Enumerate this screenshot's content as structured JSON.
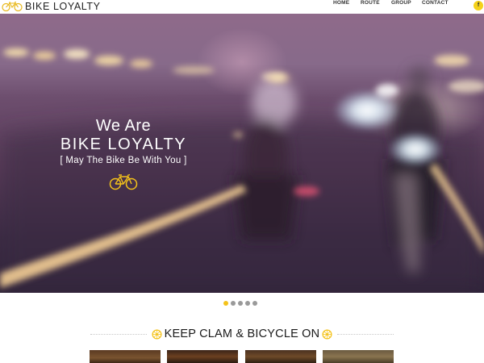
{
  "header": {
    "logo_text": "BIKE  LOYALTY",
    "nav": {
      "home": "HOME",
      "route": "ROUTE",
      "group": "GROUP",
      "contact": "CONTACT"
    },
    "facebook_letter": "f"
  },
  "hero": {
    "line1": "We Are",
    "line2": "BIKE  LOYALTY",
    "line3": "[ May The Bike Be With You ]"
  },
  "slider": {
    "dot_count": 5,
    "active_index": 0
  },
  "section": {
    "title": "KEEP CLAM & BICYCLE ON"
  },
  "colors": {
    "accent": "#f4c21a",
    "dot_inactive": "#9a9a9a",
    "text_dark": "#1a1a1a"
  },
  "icons": {
    "logo": "bicycle-icon",
    "hero": "bicycle-icon",
    "title_decoration": "wheel-icon",
    "social": "facebook-icon"
  }
}
